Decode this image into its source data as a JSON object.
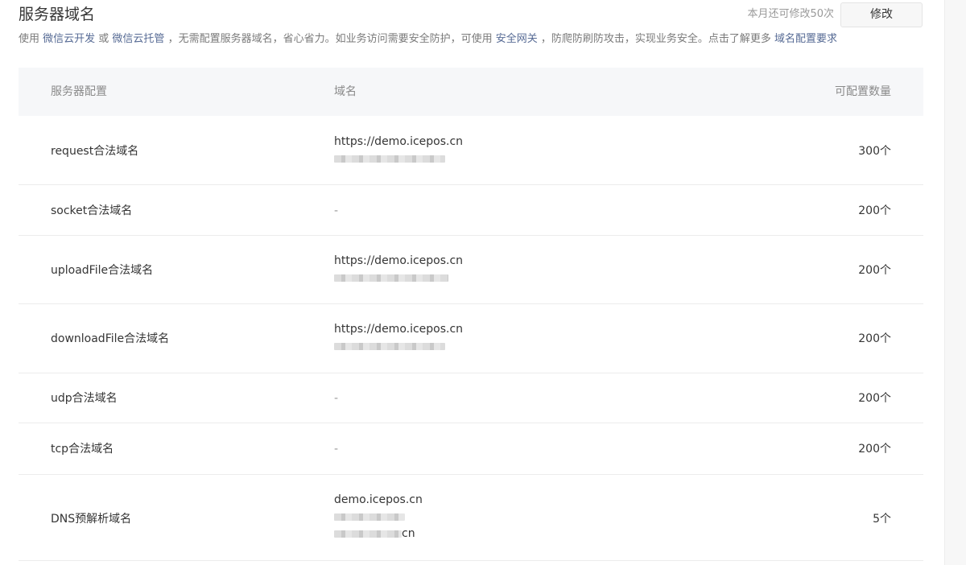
{
  "header": {
    "title": "服务器域名",
    "quota_text": "本月还可修改50次",
    "edit_button": "修改"
  },
  "description": {
    "part1": "使用 ",
    "link1": "微信云开发",
    "part2": " 或 ",
    "link2": "微信云托管",
    "part3": " ，无需配置服务器域名，省心省力。如业务访问需要安全防护，可使用 ",
    "link3": "安全网关",
    "part4": " ，防爬防刷防攻击，实现业务安全。点击了解更多 ",
    "link4": "域名配置要求"
  },
  "table": {
    "headers": {
      "config": "服务器配置",
      "domain": "域名",
      "count": "可配置数量"
    },
    "rows": [
      {
        "name": "request合法域名",
        "domain1": "https://demo.icepos.cn",
        "count": "300个"
      },
      {
        "name": "socket合法域名",
        "domain1": "-",
        "count": "200个"
      },
      {
        "name": "uploadFile合法域名",
        "domain1": "https://demo.icepos.cn",
        "count": "200个"
      },
      {
        "name": "downloadFile合法域名",
        "domain1": "https://demo.icepos.cn",
        "count": "200个"
      },
      {
        "name": "udp合法域名",
        "domain1": "-",
        "count": "200个"
      },
      {
        "name": "tcp合法域名",
        "domain1": "-",
        "count": "200个"
      },
      {
        "name": "DNS预解析域名",
        "domain1": "demo.icepos.cn",
        "domain3_tail": "cn",
        "count": "5个"
      }
    ]
  }
}
